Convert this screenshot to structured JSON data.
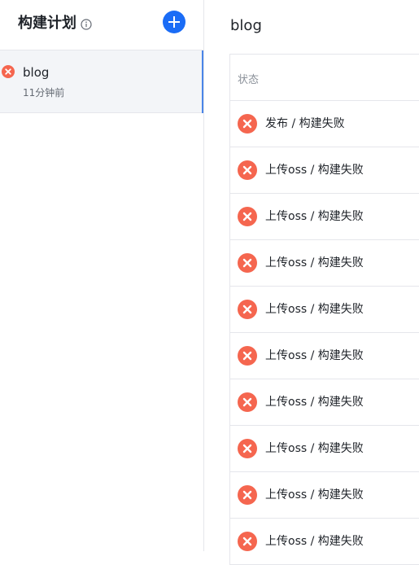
{
  "sidebar": {
    "title": "构建计划",
    "info_icon": "info-circle-icon",
    "add_icon": "plus-icon",
    "accent_color": "#1a6cf6",
    "plans": [
      {
        "name": "blog",
        "time": "11分钟前",
        "status": "failed",
        "status_icon": "x-circle-icon"
      }
    ]
  },
  "main": {
    "title": "blog",
    "table": {
      "header": "状态",
      "rows": [
        {
          "status": "发布 / 构建失败"
        },
        {
          "status": "上传oss / 构建失败"
        },
        {
          "status": "上传oss / 构建失败"
        },
        {
          "status": "上传oss / 构建失败"
        },
        {
          "status": "上传oss / 构建失败"
        },
        {
          "status": "上传oss / 构建失败"
        },
        {
          "status": "上传oss / 构建失败"
        },
        {
          "status": "上传oss / 构建失败"
        },
        {
          "status": "上传oss / 构建失败"
        },
        {
          "status": "上传oss / 构建失败"
        }
      ]
    }
  },
  "colors": {
    "fail": "#f5664f"
  }
}
